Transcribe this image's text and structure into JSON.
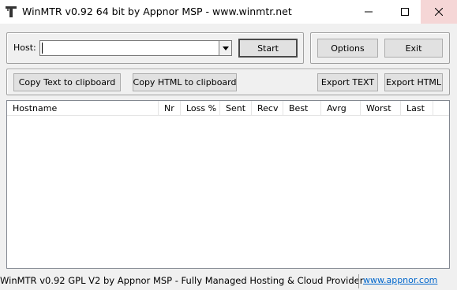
{
  "window": {
    "title": "WinMTR v0.92 64 bit by Appnor MSP - www.winmtr.net"
  },
  "host": {
    "label": "Host:",
    "value": "",
    "placeholder": ""
  },
  "buttons": {
    "start": "Start",
    "options": "Options",
    "exit": "Exit",
    "copy_text": "Copy Text to clipboard",
    "copy_html": "Copy HTML to clipboard",
    "export_text": "Export TEXT",
    "export_html": "Export HTML"
  },
  "table": {
    "columns": [
      "Hostname",
      "Nr",
      "Loss %",
      "Sent",
      "Recv",
      "Best",
      "Avrg",
      "Worst",
      "Last"
    ],
    "rows": []
  },
  "status": {
    "text": "WinMTR v0.92 GPL V2 by Appnor MSP - Fully Managed Hosting & Cloud Provider",
    "link": "www.appnor.com"
  },
  "colors": {
    "close_hover_bg": "#f5d6d6",
    "link": "#0066cc"
  },
  "icons": [
    "app-icon",
    "minimize-icon",
    "maximize-icon",
    "close-icon",
    "dropdown-arrow-icon"
  ]
}
